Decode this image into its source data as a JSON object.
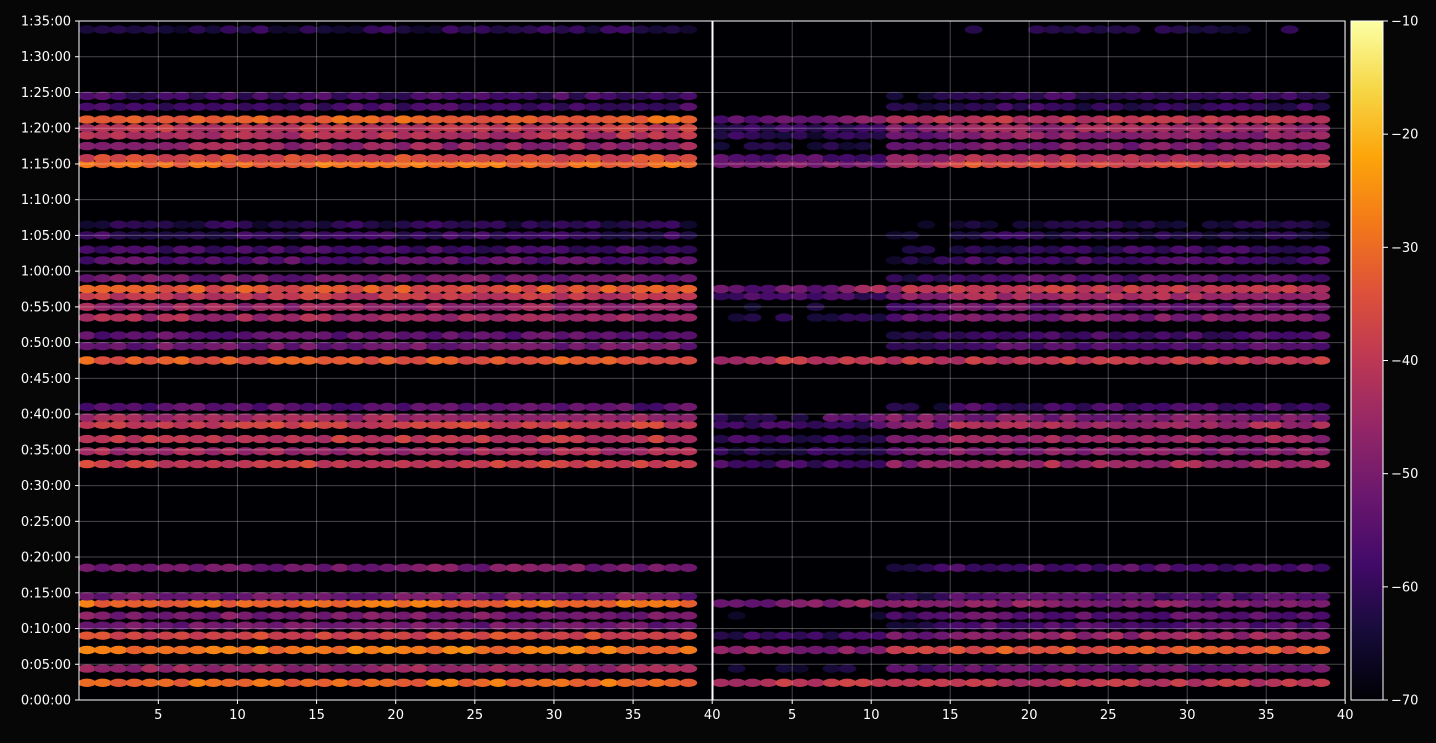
{
  "chart_data": {
    "type": "heatmap",
    "title": "",
    "xlabel": "",
    "ylabel": "",
    "panels": [
      {
        "name": "",
        "xlim": [
          1,
          40
        ],
        "x_ticks": [
          5,
          10,
          15,
          20,
          25,
          30,
          35,
          40
        ]
      },
      {
        "name": "",
        "xlim": [
          1,
          40
        ],
        "x_ticks": [
          5,
          10,
          15,
          20,
          25,
          30,
          35,
          40
        ]
      }
    ],
    "ylim_minutes": [
      0,
      95
    ],
    "y_ticks": [
      "0:00:00",
      "0:05:00",
      "0:10:00",
      "0:15:00",
      "0:20:00",
      "0:25:00",
      "0:30:00",
      "0:35:00",
      "0:40:00",
      "0:45:00",
      "0:50:00",
      "0:55:00",
      "1:00:00",
      "1:05:00",
      "1:10:00",
      "1:15:00",
      "1:20:00",
      "1:25:00",
      "1:30:00",
      "1:35:00"
    ],
    "grid": true,
    "colormap": "inferno",
    "colorbar": {
      "vmin": -70,
      "vmax": -10,
      "ticks": [
        -70,
        -60,
        -50,
        -40,
        -30,
        -20,
        -10
      ]
    },
    "bands_minutes_db": {
      "left": [
        [
          2.4,
          -30
        ],
        [
          4.4,
          -46
        ],
        [
          7.0,
          -28
        ],
        [
          9.0,
          -36
        ],
        [
          10.4,
          -52
        ],
        [
          11.8,
          -50
        ],
        [
          13.5,
          -30
        ],
        [
          14.5,
          -52
        ],
        [
          18.5,
          -50
        ],
        [
          33.0,
          -38
        ],
        [
          34.8,
          -44
        ],
        [
          36.5,
          -40
        ],
        [
          38.5,
          -38
        ],
        [
          39.5,
          -45
        ],
        [
          41.0,
          -55
        ],
        [
          47.5,
          -33
        ],
        [
          49.5,
          -52
        ],
        [
          51.0,
          -54
        ],
        [
          53.5,
          -44
        ],
        [
          55.0,
          -46
        ],
        [
          56.5,
          -40
        ],
        [
          57.5,
          -34
        ],
        [
          59.0,
          -52
        ],
        [
          61.5,
          -55
        ],
        [
          63.0,
          -58
        ],
        [
          65.0,
          -60
        ],
        [
          66.5,
          -62
        ],
        [
          75.0,
          -30
        ],
        [
          75.8,
          -36
        ],
        [
          77.5,
          -46
        ],
        [
          79.0,
          -42
        ],
        [
          80.0,
          -40
        ],
        [
          81.2,
          -32
        ],
        [
          83.0,
          -58
        ],
        [
          84.5,
          -58
        ],
        [
          93.8,
          -62
        ]
      ],
      "right": [
        [
          2.4,
          -40
        ],
        [
          4.4,
          -52
        ],
        [
          7.0,
          -34
        ],
        [
          9.0,
          -46
        ],
        [
          10.4,
          -56
        ],
        [
          11.8,
          -54
        ],
        [
          13.5,
          -48
        ],
        [
          14.5,
          -56
        ],
        [
          18.5,
          -56
        ],
        [
          33.0,
          -44
        ],
        [
          34.8,
          -48
        ],
        [
          36.5,
          -46
        ],
        [
          38.5,
          -44
        ],
        [
          39.5,
          -50
        ],
        [
          41.0,
          -58
        ],
        [
          47.5,
          -40
        ],
        [
          49.5,
          -56
        ],
        [
          51.0,
          -58
        ],
        [
          53.5,
          -50
        ],
        [
          55.0,
          -52
        ],
        [
          56.5,
          -44
        ],
        [
          57.5,
          -40
        ],
        [
          59.0,
          -56
        ],
        [
          61.5,
          -58
        ],
        [
          63.0,
          -60
        ],
        [
          65.0,
          -62
        ],
        [
          66.5,
          -64
        ],
        [
          75.0,
          -36
        ],
        [
          75.8,
          -42
        ],
        [
          77.5,
          -50
        ],
        [
          79.0,
          -48
        ],
        [
          80.0,
          -46
        ],
        [
          81.2,
          -40
        ],
        [
          83.0,
          -60
        ],
        [
          84.5,
          -60
        ],
        [
          93.8,
          -64
        ]
      ]
    },
    "right_panel_onset_x": {
      "2.4": 1,
      "7.0": 1,
      "13.5": 1,
      "47.5": 1,
      "57.5": 9,
      "39.5": 8,
      "75.0": 15,
      "81.2": 9
    }
  }
}
